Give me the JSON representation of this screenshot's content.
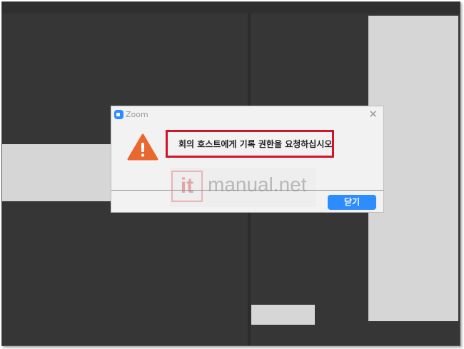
{
  "dialog": {
    "app_title": "Zoom",
    "close_glyph": "✕",
    "message": "회의 호스트에게 기록 권한을 요청하십시오",
    "close_button_label": "닫기",
    "icon": "warning-icon",
    "accent_color": "#2d8cff",
    "warning_color": "#e8682f",
    "highlight_color": "#d0142a"
  },
  "watermark": {
    "logo_text": "it",
    "text": "manual.net"
  }
}
